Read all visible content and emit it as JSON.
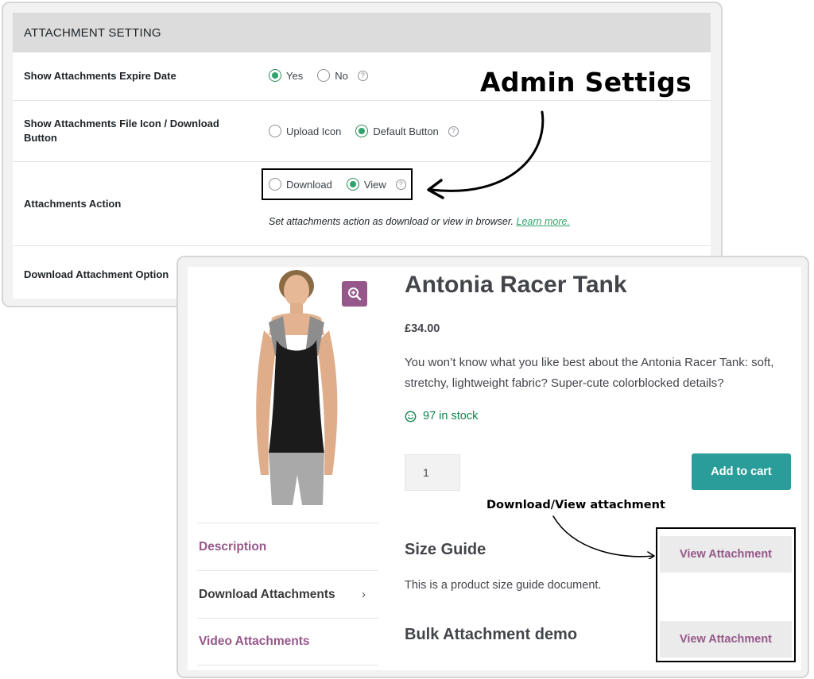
{
  "admin": {
    "header": "ATTACHMENT SETTING",
    "rows": [
      {
        "label": "Show Attachments Expire Date",
        "options": [
          {
            "label": "Yes",
            "selected": true
          },
          {
            "label": "No",
            "selected": false
          }
        ]
      },
      {
        "label": "Show Attachments File Icon / Download Button",
        "options": [
          {
            "label": "Upload Icon",
            "selected": false
          },
          {
            "label": "Default Button",
            "selected": true
          }
        ]
      },
      {
        "label": "Attachments Action",
        "options": [
          {
            "label": "Download",
            "selected": false
          },
          {
            "label": "View",
            "selected": true
          }
        ],
        "description": "Set attachments action as download or view in browser.",
        "learn_more": "Learn more."
      },
      {
        "label": "Download Attachment Option"
      }
    ],
    "help_glyph": "?",
    "annotation": "Admin Settigs"
  },
  "product": {
    "title": "Antonia Racer Tank",
    "price": "£34.00",
    "description": "You won’t know what you like best about the Antonia Racer Tank: soft, stretchy, lightweight fabric? Super-cute colorblocked details?",
    "stock": "97 in stock",
    "quantity": "1",
    "add_to_cart": "Add to cart",
    "zoom_icon": "magnify-plus-icon",
    "tabs": [
      {
        "label": "Description"
      },
      {
        "label": "Download Attachments",
        "chevron": "›"
      },
      {
        "label": "Video Attachments"
      }
    ],
    "annotation": "Download/View attachment",
    "attachments": [
      {
        "heading": "Size Guide",
        "description": "This is a product size guide document.",
        "button": "View Attachment"
      },
      {
        "heading": "Bulk Attachment demo",
        "button": "View Attachment"
      }
    ]
  },
  "colors": {
    "radio_selected": "#2fa36b",
    "brand_purple": "#96588a",
    "cart_button": "#2a9d9a",
    "stock_green": "#0f834d"
  }
}
